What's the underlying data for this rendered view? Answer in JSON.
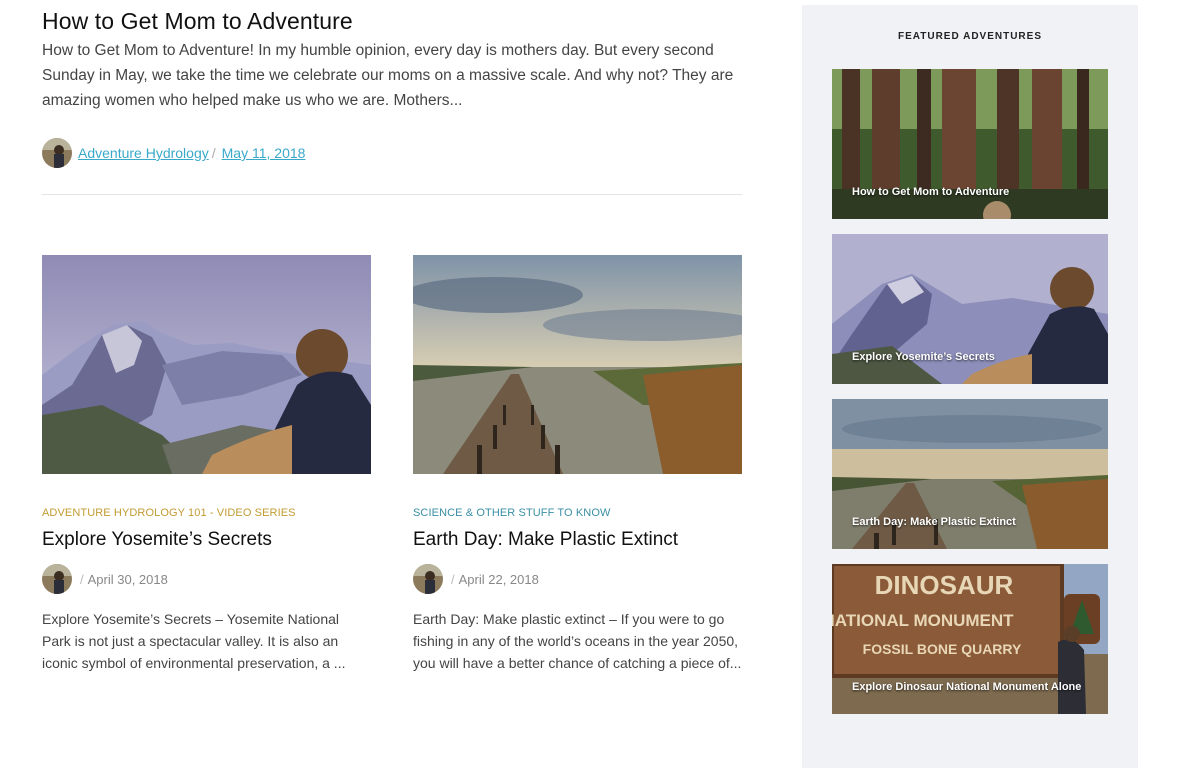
{
  "lead_post": {
    "title": "How to Get Mom to Adventure",
    "excerpt": "How to Get Mom to Adventure! In my humble opinion, every day is mothers day. But every second Sunday in May, we take the time we celebrate our moms on a massive scale.  And why not?  They are amazing women who helped make us who we are.  Mothers...",
    "author": "Adventure Hydrology ",
    "separator": "/",
    "date": "May 11, 2018",
    "avatar_icon": "author-avatar"
  },
  "posts": [
    {
      "category": "ADVENTURE HYDROLOGY 101 - VIDEO SERIES",
      "title": "Explore Yosemite’s Secrets",
      "separator": "/",
      "date": "April 30, 2018",
      "excerpt": "Explore Yosemite’s Secrets – Yosemite National Park is not just a spectacular valley.  It is also an iconic symbol of environmental preservation, a ...",
      "category_color": "#c29b31",
      "image": "yosemite-half-dome-photo"
    },
    {
      "category": "SCIENCE & OTHER STUFF TO KNOW",
      "title": "Earth Day: Make Plastic Extinct",
      "separator": "/",
      "date": "April 22, 2018",
      "excerpt": "Earth Day: Make plastic extinct – If you were to go fishing in any of the world’s oceans in the year 2050,  you will have a better chance of catching a piece of...",
      "category_color": "#3a8fa5",
      "image": "wooden-pier-lake-photo"
    }
  ],
  "sidebar": {
    "heading": "FEATURED ADVENTURES",
    "items": [
      {
        "label": "How to Get Mom to Adventure",
        "image": "redwood-forest-photo"
      },
      {
        "label": "Explore Yosemite’s Secrets",
        "image": "yosemite-half-dome-photo"
      },
      {
        "label": "Earth Day: Make Plastic Extinct",
        "image": "wooden-pier-lake-photo"
      },
      {
        "label": "Explore Dinosaur National Monument Alone",
        "image": "dinosaur-monument-sign-photo"
      }
    ],
    "sign_lines": [
      "DINOSAUR",
      "NATIONAL MONUMENT",
      "FOSSIL BONE QUARRY"
    ]
  },
  "colors": {
    "link": "#39a9c9",
    "sidebar_bg": "#f1f2f5",
    "category_yellow": "#c29b31",
    "category_teal": "#3a8fa5"
  }
}
